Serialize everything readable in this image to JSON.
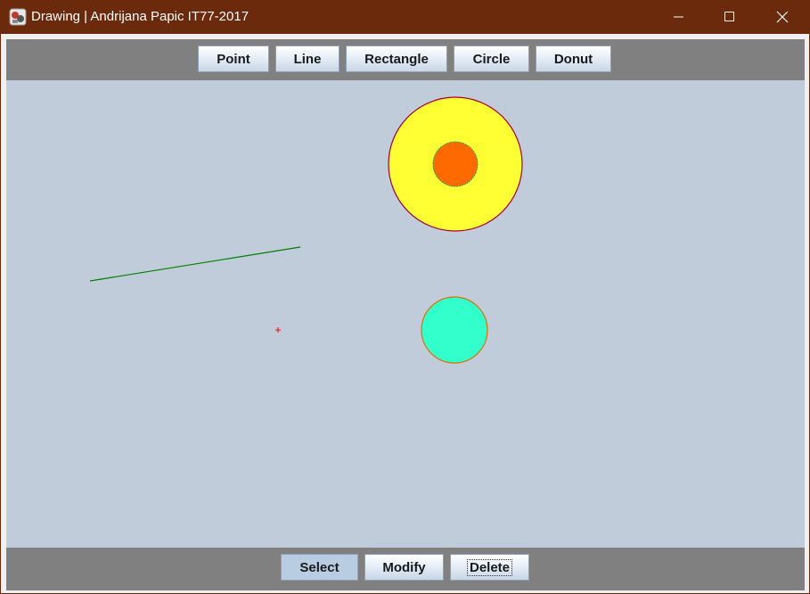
{
  "window": {
    "title": "Drawing | Andrijana Papic IT77-2017",
    "icon": "app-drawing-icon",
    "controls": [
      "minimize-icon",
      "maximize-icon",
      "close-icon"
    ]
  },
  "shape_toolbar": {
    "buttons": [
      {
        "label": "Point"
      },
      {
        "label": "Line"
      },
      {
        "label": "Rectangle"
      },
      {
        "label": "Circle"
      },
      {
        "label": "Donut"
      }
    ]
  },
  "action_toolbar": {
    "buttons": [
      {
        "label": "Select",
        "state": "pressed"
      },
      {
        "label": "Modify"
      },
      {
        "label": "Delete",
        "state": "focused"
      }
    ]
  },
  "canvas": {
    "background": "#c0ccd9",
    "shapes": [
      {
        "type": "donut",
        "fill": "#ffff33",
        "outline": "#aa0033",
        "inner_fill": "#ff6a00",
        "inner_outline": "#22aa55"
      },
      {
        "type": "line",
        "color": "#008000"
      },
      {
        "type": "point",
        "color": "#ff0000"
      },
      {
        "type": "circle",
        "fill": "#33ffcc",
        "outline": "#e07000"
      }
    ]
  },
  "colors": {
    "titlebar": "#6b2a0c",
    "toolbar": "#808080"
  }
}
